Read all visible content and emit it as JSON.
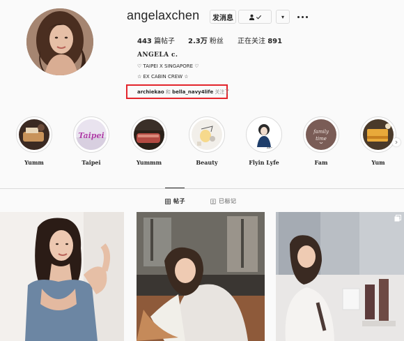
{
  "profile": {
    "username": "angelaxchen",
    "message_button": "发消息",
    "dropdown_glyph": "▾",
    "fullname": "ANGELA c.",
    "bio_line1": "♡ TAIPEI X SINGAPORE ♡",
    "bio_line2": "☆ EX CABIN CREW ☆",
    "posts_count": "443",
    "posts_label": "篇帖子",
    "followers_count": "2.3万",
    "followers_label": "粉丝",
    "following_label": "正在关注",
    "following_count": "891",
    "followed_by": {
      "account1": "archiekao",
      "conjunction": "和",
      "account2": "bella_navy4life",
      "suffix": "关注了"
    }
  },
  "highlights": [
    {
      "label": "Yumm",
      "icon": "food-plate-icon"
    },
    {
      "label": "Taipei",
      "icon": "taipei-text-icon"
    },
    {
      "label": "Yummm",
      "icon": "meat-dish-icon"
    },
    {
      "label": "Beauty",
      "icon": "beauty-sketch-icon"
    },
    {
      "label": "Flyin Lyfe",
      "icon": "flight-attendant-sketch-icon"
    },
    {
      "label": "Fam",
      "icon": "family-time-icon"
    },
    {
      "label": "Yum",
      "icon": "dessert-icon"
    }
  ],
  "tabs": [
    {
      "label": "帖子",
      "icon": "grid-icon",
      "active": true
    },
    {
      "label": "已标记",
      "icon": "tag-icon",
      "active": false
    }
  ],
  "colors": {
    "highlight_box": "#e3242b",
    "text": "#262626",
    "muted": "#8e8e8e",
    "border": "#dbdbdb"
  }
}
